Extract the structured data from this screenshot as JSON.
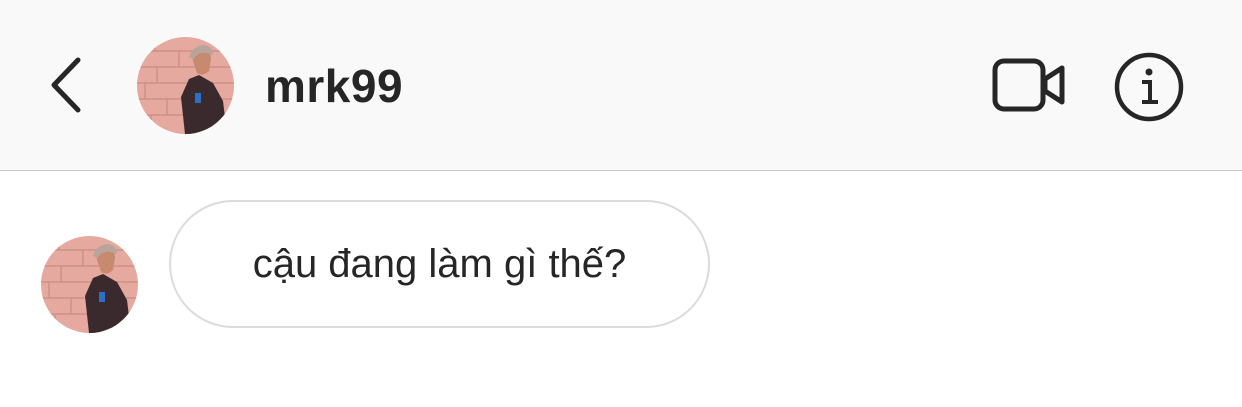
{
  "header": {
    "username": "mrk99",
    "back_icon": "chevron-left-icon",
    "video_icon": "video-camera-icon",
    "info_icon": "info-icon",
    "background": "#f9f9f9"
  },
  "conversation": {
    "messages": [
      {
        "sender": "incoming",
        "text": "cậu đang làm gì thế?"
      }
    ]
  },
  "colors": {
    "text": "#262626",
    "bubble_border": "#dbdbdb",
    "divider": "#c8c8c8"
  }
}
